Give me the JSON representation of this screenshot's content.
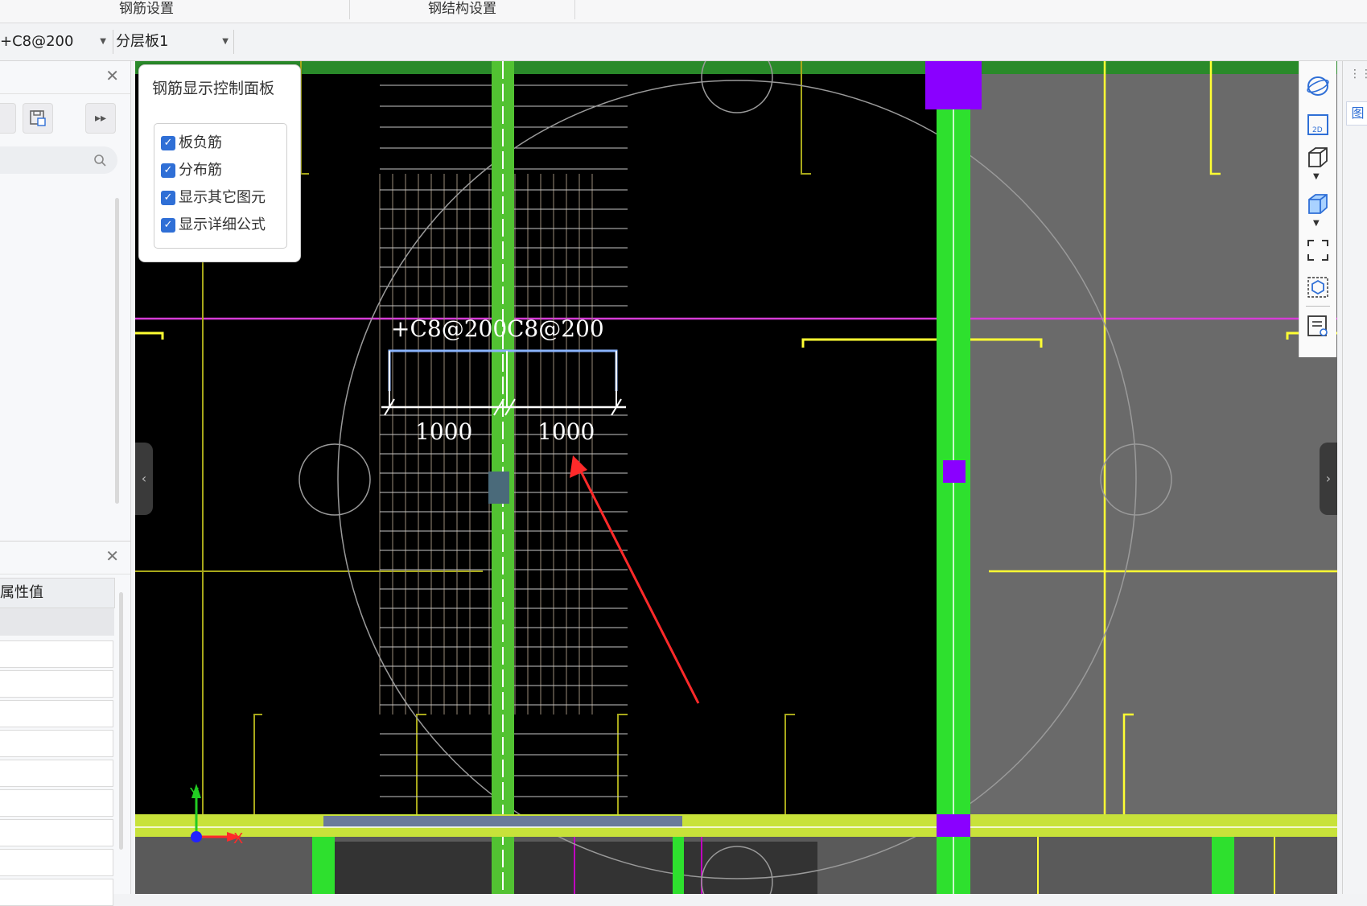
{
  "topbar": {
    "sections": [
      "钢筋设置",
      "钢结构设置"
    ]
  },
  "propbar": {
    "rebar_spec": "+C8@200",
    "layer": "分层板1"
  },
  "left_panel": {
    "props_header": "属性值"
  },
  "control_panel": {
    "title": "钢筋显示控制面板",
    "options": [
      {
        "label": "板负筋",
        "checked": true
      },
      {
        "label": "分布筋",
        "checked": true
      },
      {
        "label": "显示其它图元",
        "checked": true
      },
      {
        "label": "显示详细公式",
        "checked": true
      }
    ]
  },
  "canvas": {
    "rebar_label_left": "+C8@200",
    "rebar_label_right": "C8@200",
    "dim_left": "1000",
    "dim_right": "1000",
    "axis_x": "X",
    "axis_y": "Y"
  },
  "colors": {
    "beam_green": "#2ee02e",
    "wall_yellow": "#ffff33",
    "axis_magenta": "#d63cd6",
    "column_purple": "#8a00ff",
    "slab_gray": "#6a6a6a",
    "checkbox_blue": "#2f6fd6",
    "arrow_red": "#ff2a2a"
  },
  "right_tools": {
    "icons": [
      "orbit-icon",
      "view-2d-icon",
      "cube-icon",
      "cube-shaded-icon",
      "fit-view-icon",
      "box-select-icon",
      "layer-list-icon"
    ]
  },
  "far_right": {
    "tab": "图"
  }
}
